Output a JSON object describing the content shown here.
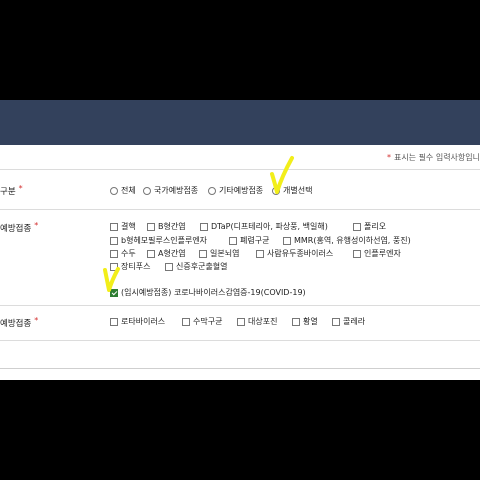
{
  "notice": {
    "star": "*",
    "text": "표시는 필수 입력사항입니"
  },
  "type_row": {
    "label": "구분",
    "required": "*",
    "options": [
      {
        "label": "전체",
        "selected": false
      },
      {
        "label": "국가예방접종",
        "selected": false
      },
      {
        "label": "기타예방접종",
        "selected": false
      },
      {
        "label": "개별선택",
        "selected": true
      }
    ]
  },
  "national_row": {
    "label": "예방접종",
    "required": "*",
    "vaccines": [
      {
        "label": "결핵",
        "checked": false
      },
      {
        "label": "B형간염",
        "checked": false
      },
      {
        "label": "DTaP(디프테리아, 파상풍, 백일해)",
        "checked": false
      },
      {
        "label": "폴리오",
        "checked": false
      },
      {
        "label": "b형헤모필루스인플루엔자",
        "checked": false
      },
      {
        "label": "폐렴구균",
        "checked": false
      },
      {
        "label": "MMR(홍역, 유행성이하선염, 풍진)",
        "checked": false
      },
      {
        "label": "수두",
        "checked": false
      },
      {
        "label": "A형간염",
        "checked": false
      },
      {
        "label": "일본뇌염",
        "checked": false
      },
      {
        "label": "사람유두종바이러스",
        "checked": false
      },
      {
        "label": "인플루엔자",
        "checked": false
      },
      {
        "label": "장티푸스",
        "checked": false
      },
      {
        "label": "신증후군출혈열",
        "checked": false
      },
      {
        "label": "(임시예방접종) 코로나바이러스감염증-19(COVID-19)",
        "checked": true
      }
    ]
  },
  "other_row": {
    "label": "예방접종",
    "required": "*",
    "vaccines": [
      {
        "label": "로타바이러스",
        "checked": false
      },
      {
        "label": "수막구균",
        "checked": false
      },
      {
        "label": "대상포진",
        "checked": false
      },
      {
        "label": "황열",
        "checked": false
      },
      {
        "label": "콜레라",
        "checked": false
      }
    ]
  },
  "colors": {
    "header": "#33415c",
    "highlight": "#f2ee1a",
    "required": "#d32f2f",
    "checked": "#2e7d32"
  }
}
